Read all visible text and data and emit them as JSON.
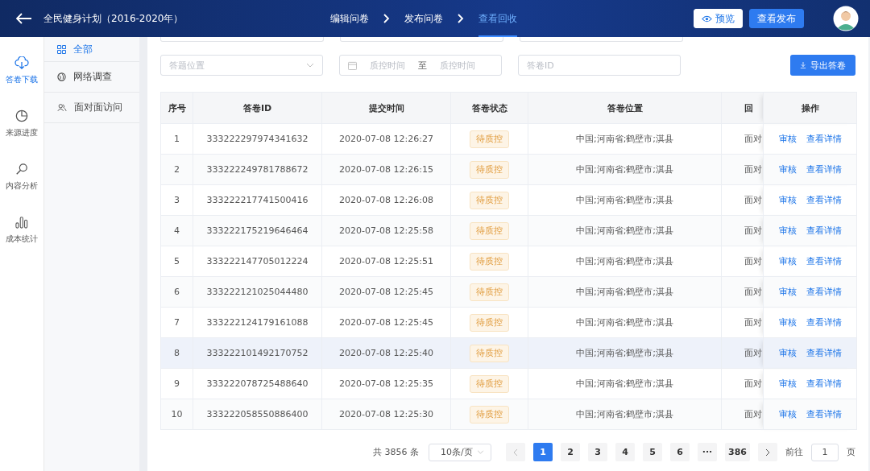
{
  "header": {
    "title": "全民健身计划（2016-2020年）",
    "steps": [
      {
        "label": "编辑问卷",
        "selected": false
      },
      {
        "label": "发布问卷",
        "selected": false
      },
      {
        "label": "查看回收",
        "selected": true
      }
    ],
    "buttons": [
      {
        "label": "预览",
        "kind": "outline"
      },
      {
        "label": "查看发布",
        "kind": "primary"
      }
    ]
  },
  "rail": [
    {
      "label": "答卷下载",
      "kind": "download",
      "selected": true
    },
    {
      "label": "来源进度",
      "kind": "progress",
      "selected": false
    },
    {
      "label": "内容分析",
      "kind": "analysis",
      "selected": false
    },
    {
      "label": "成本统计",
      "kind": "statistics",
      "selected": false
    }
  ],
  "subnav": [
    {
      "label": "全部",
      "kind": "all",
      "selected": true
    },
    {
      "label": "网络调查",
      "kind": "online",
      "selected": false
    },
    {
      "label": "面对面访问",
      "kind": "interview",
      "selected": false
    }
  ],
  "filters": {
    "location": {
      "placeholder": "答题位置"
    },
    "date_range": {
      "start_placeholder": "质控时间",
      "separator": "至",
      "end_placeholder": "质控时间"
    },
    "id_field": {
      "placeholder": "答卷ID"
    },
    "export_button": "导出答卷"
  },
  "table": {
    "columns": [
      "序号",
      "答卷ID",
      "提交时间",
      "答卷状态",
      "答卷位置",
      "回",
      "操作"
    ],
    "rows": [
      {
        "no": "1",
        "id": "333222297974341632",
        "time": "2020-07-08 12:26:27",
        "status": "待质控",
        "location": "中国;河南省;鹤壁市;淇县",
        "column_6": "面对",
        "actions": [
          "审核",
          "查看详情"
        ],
        "hovered": false
      },
      {
        "no": "2",
        "id": "333222249781788672",
        "time": "2020-07-08 12:26:15",
        "status": "待质控",
        "location": "中国;河南省;鹤壁市;淇县",
        "column_6": "面对",
        "actions": [
          "审核",
          "查看详情"
        ],
        "hovered": false
      },
      {
        "no": "3",
        "id": "333222217741500416",
        "time": "2020-07-08 12:26:08",
        "status": "待质控",
        "location": "中国;河南省;鹤壁市;淇县",
        "column_6": "面对",
        "actions": [
          "审核",
          "查看详情"
        ],
        "hovered": false
      },
      {
        "no": "4",
        "id": "333222175219646464",
        "time": "2020-07-08 12:25:58",
        "status": "待质控",
        "location": "中国;河南省;鹤壁市;淇县",
        "column_6": "面对",
        "actions": [
          "审核",
          "查看详情"
        ],
        "hovered": false
      },
      {
        "no": "5",
        "id": "333222147705012224",
        "time": "2020-07-08 12:25:51",
        "status": "待质控",
        "location": "中国;河南省;鹤壁市;淇县",
        "column_6": "面对",
        "actions": [
          "审核",
          "查看详情"
        ],
        "hovered": false
      },
      {
        "no": "6",
        "id": "333222121025044480",
        "time": "2020-07-08 12:25:45",
        "status": "待质控",
        "location": "中国;河南省;鹤壁市;淇县",
        "column_6": "面对",
        "actions": [
          "审核",
          "查看详情"
        ],
        "hovered": false
      },
      {
        "no": "7",
        "id": "333222124179161088",
        "time": "2020-07-08 12:25:45",
        "status": "待质控",
        "location": "中国;河南省;鹤壁市;淇县",
        "column_6": "面对",
        "actions": [
          "审核",
          "查看详情"
        ],
        "hovered": false
      },
      {
        "no": "8",
        "id": "333222101492170752",
        "time": "2020-07-08 12:25:40",
        "status": "待质控",
        "location": "中国;河南省;鹤壁市;淇县",
        "column_6": "面对",
        "actions": [
          "审核",
          "查看详情"
        ],
        "hovered": true
      },
      {
        "no": "9",
        "id": "333222078725488640",
        "time": "2020-07-08 12:25:35",
        "status": "待质控",
        "location": "中国;河南省;鹤壁市;淇县",
        "column_6": "面对",
        "actions": [
          "审核",
          "查看详情"
        ],
        "hovered": false
      },
      {
        "no": "10",
        "id": "333222058550886400",
        "time": "2020-07-08 12:25:30",
        "status": "待质控",
        "location": "中国;河南省;鹤壁市;淇县",
        "column_6": "面对",
        "actions": [
          "审核",
          "查看详情"
        ],
        "hovered": false
      }
    ]
  },
  "pagination": {
    "total": "共 3856 条",
    "page_size": "10条/页",
    "pages": [
      {
        "label": "1",
        "selected": true
      },
      {
        "label": "2",
        "selected": false
      },
      {
        "label": "3",
        "selected": false
      },
      {
        "label": "4",
        "selected": false
      },
      {
        "label": "5",
        "selected": false
      },
      {
        "label": "6",
        "selected": false
      },
      {
        "label": "···",
        "selected": false
      },
      {
        "label": "386",
        "selected": false
      }
    ],
    "goto_label": "前往",
    "goto_value": "1",
    "page_unit": "页"
  }
}
